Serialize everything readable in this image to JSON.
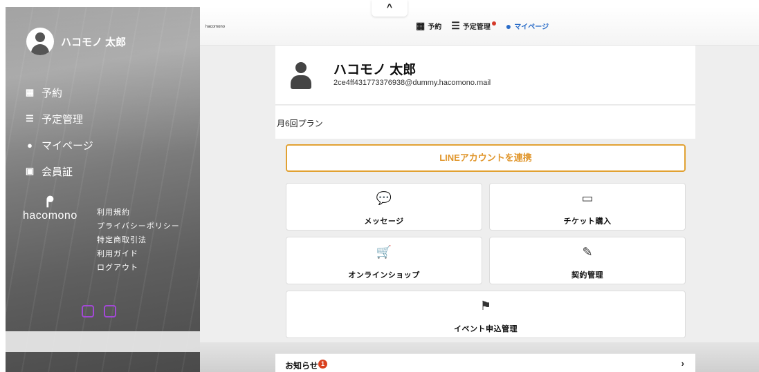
{
  "sidebar": {
    "user_name": "ハコモノ 太郎",
    "nav": [
      {
        "icon": "calendar-icon",
        "glyph": "▦",
        "label": "予約"
      },
      {
        "icon": "list-icon",
        "glyph": "☰",
        "label": "予定管理"
      },
      {
        "icon": "user-circle-icon",
        "glyph": "●",
        "label": "マイページ"
      },
      {
        "icon": "qr-icon",
        "glyph": "▣",
        "label": "会員証"
      }
    ],
    "logo_mark": "ᖰ",
    "logo_text": "hacomono",
    "links": [
      "利用規約",
      "プライバシーポリシー",
      "特定商取引法",
      "利用ガイド",
      "ログアウト"
    ]
  },
  "header": {
    "brand": "hacomono",
    "collapse_glyph": "^",
    "nav": [
      {
        "icon": "calendar-icon",
        "glyph": "▦",
        "label": "予約"
      },
      {
        "icon": "list-icon",
        "glyph": "☰",
        "label": "予定管理"
      },
      {
        "icon": "user-circle-icon",
        "glyph": "●",
        "label": "マイページ"
      }
    ]
  },
  "profile": {
    "name": "ハコモノ 太郎",
    "email": "2ce4ff431773376938@dummy.hacomono.mail",
    "plan": "月6回プラン"
  },
  "line_button": "LINEアカウントを連携",
  "tiles": [
    {
      "icon": "chat-icon",
      "glyph": "💬",
      "label": "メッセージ"
    },
    {
      "icon": "ticket-icon",
      "glyph": "▭",
      "label": "チケット購入"
    },
    {
      "icon": "cart-icon",
      "glyph": "🛒",
      "label": "オンラインショップ"
    },
    {
      "icon": "contract-icon",
      "glyph": "✎",
      "label": "契約管理"
    },
    {
      "icon": "flag-icon",
      "glyph": "⚑",
      "label": "イベント申込管理"
    }
  ],
  "news": {
    "title": "お知らせ",
    "count": "1",
    "arrow": "›"
  },
  "colors": {
    "accent_orange": "#e0952a",
    "active_blue": "#2a6cc8",
    "badge_red": "#d9401f"
  }
}
